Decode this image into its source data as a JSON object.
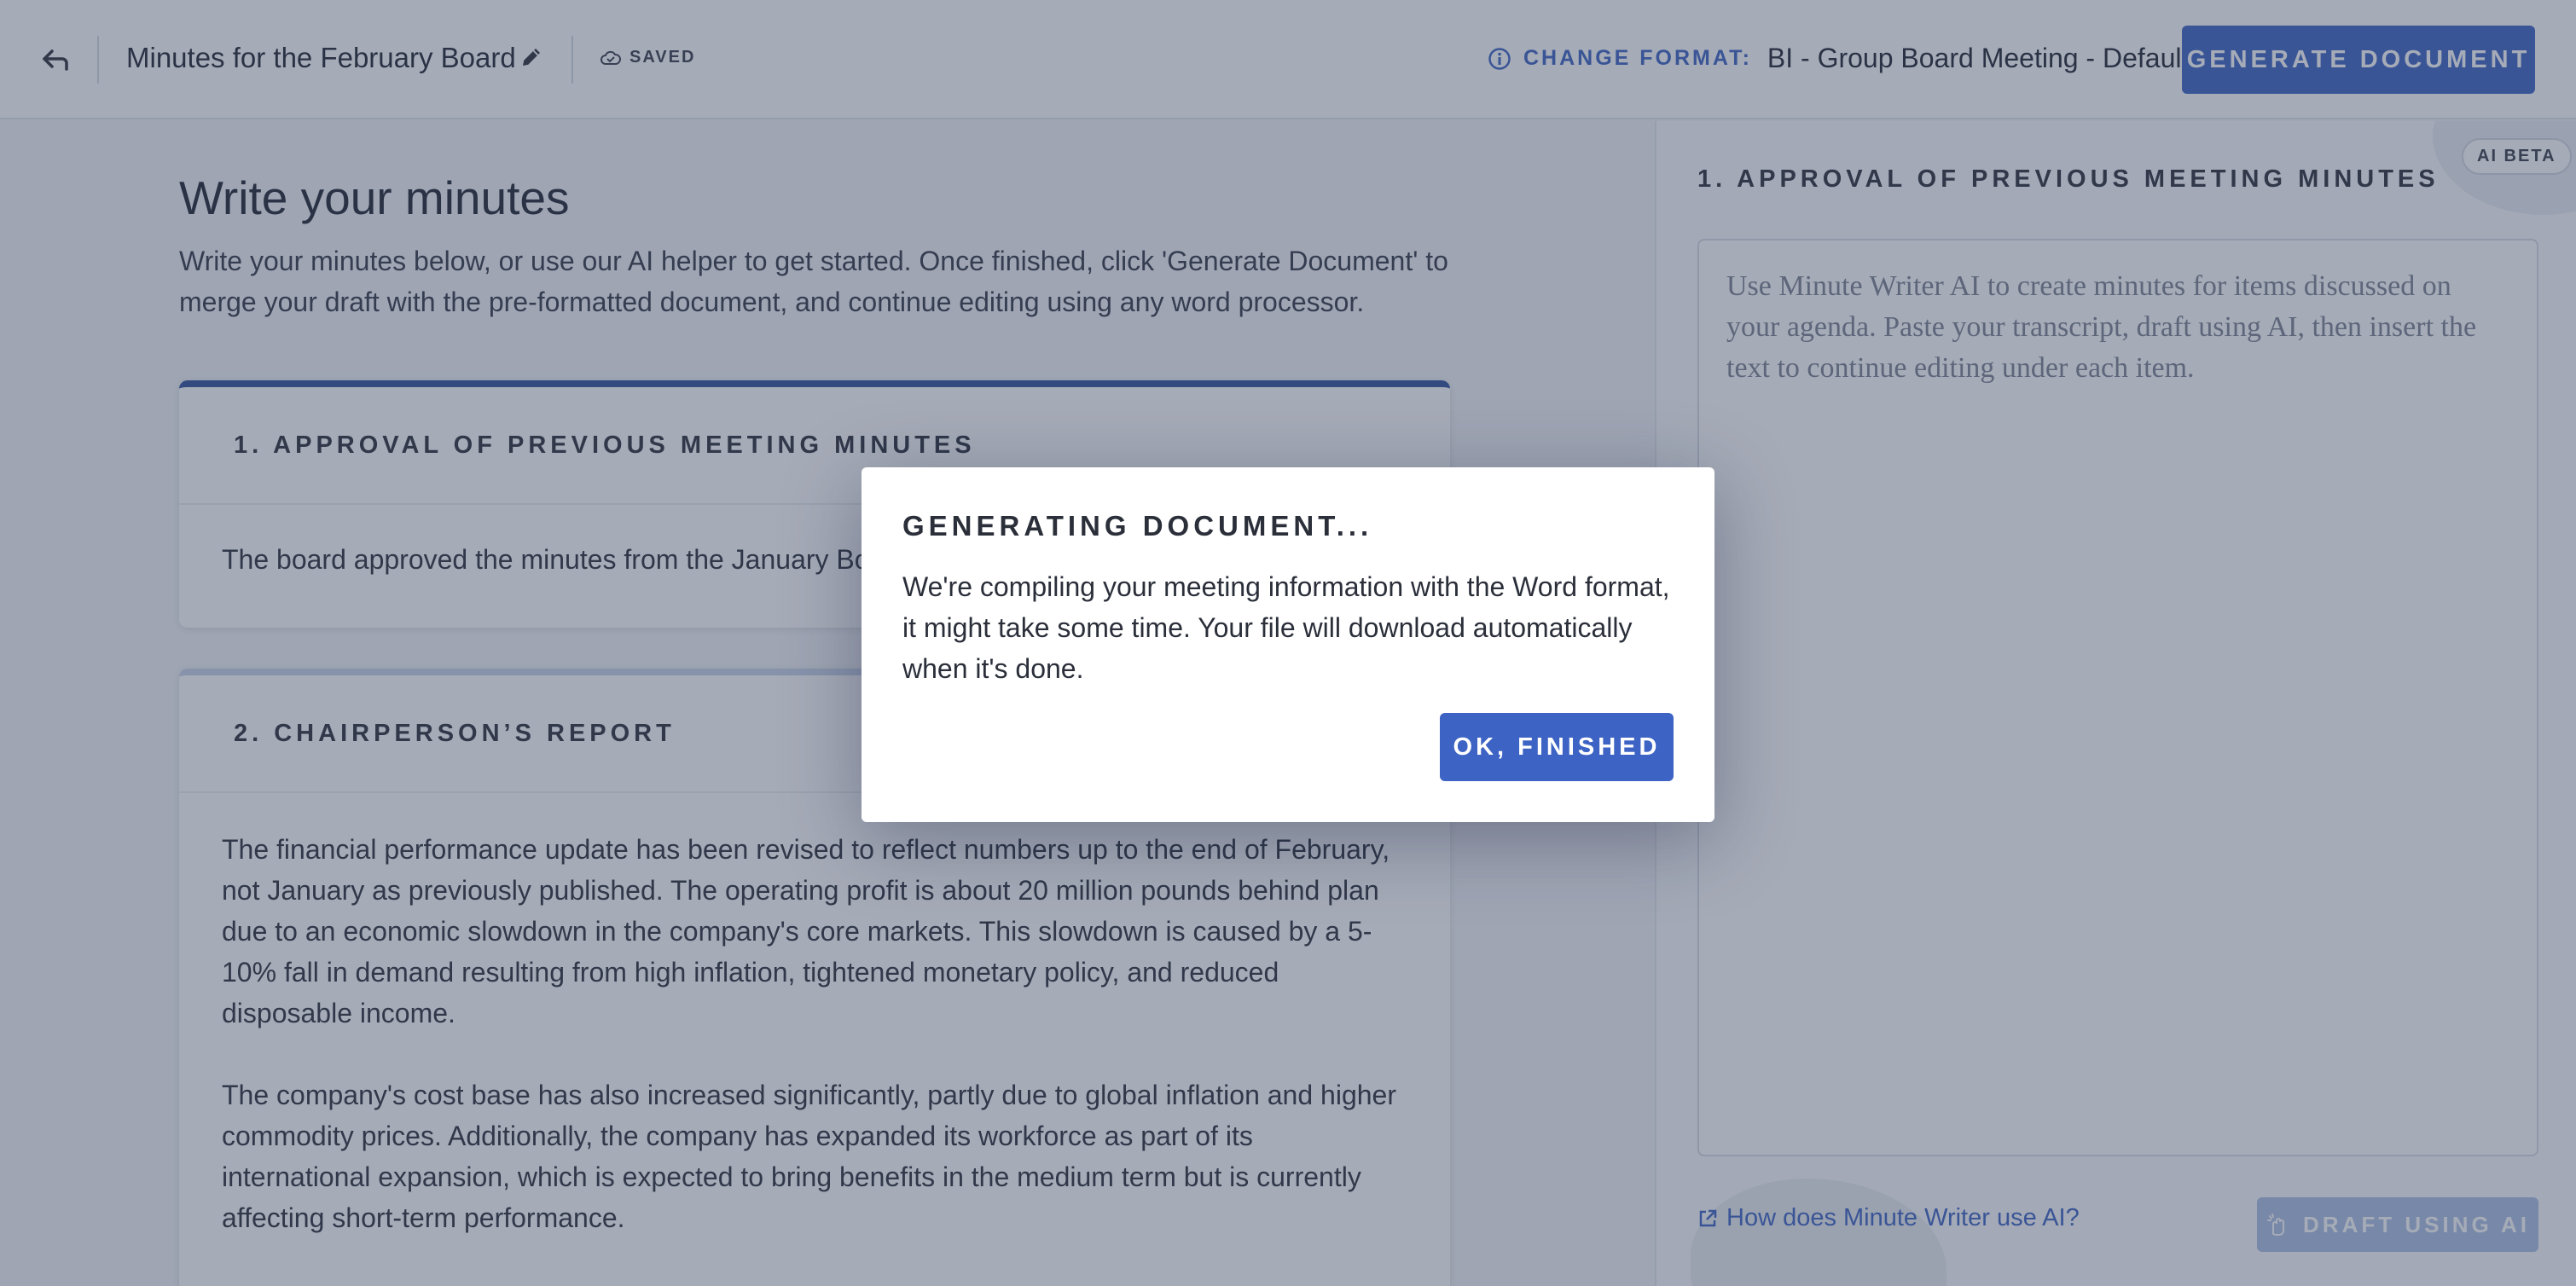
{
  "header": {
    "document_title": "Minutes for the February Board",
    "saved_label": "SAVED",
    "change_format_label": "CHANGE FORMAT:",
    "format_value": "BI - Group Board Meeting - Default",
    "generate_label": "GENERATE DOCUMENT",
    "icons": {
      "back": "back-arrow-icon",
      "edit": "pencil-icon",
      "saved": "cloud-check-icon",
      "info": "info-circle-icon"
    }
  },
  "main": {
    "heading": "Write your minutes",
    "description": "Write your minutes below, or use our AI helper to get started. Once finished, click 'Generate Document' to merge your draft with the pre-formatted document, and continue editing using any word processor.",
    "items": [
      {
        "title": "1. APPROVAL OF PREVIOUS MEETING MINUTES",
        "paragraphs": [
          "The board approved the minutes from the January Board meeting."
        ]
      },
      {
        "title": "2. CHAIRPERSON’S REPORT",
        "paragraphs": [
          "The financial performance update has been revised to reflect numbers up to the end of February, not January as previously published. The operating profit is about 20 million pounds behind plan due to an economic slowdown in the company's core markets. This slowdown is caused by a 5-10% fall in demand resulting from high inflation, tightened monetary policy, and reduced disposable income.",
          "The company's cost base has also increased significantly, partly due to global inflation and higher commodity prices. Additionally, the company has expanded its workforce as part of its international expansion, which is expected to bring benefits in the medium term but is currently affecting short-term performance."
        ]
      }
    ]
  },
  "ai_panel": {
    "badge": "AI BETA",
    "title": "1. APPROVAL OF PREVIOUS MEETING MINUTES",
    "placeholder": "Use Minute Writer AI to create minutes for items discussed on your agenda. Paste your transcript, draft using AI, then insert the text to continue editing under each item.",
    "help_link": "How does Minute Writer use AI?",
    "draft_label": "DRAFT USING AI"
  },
  "modal": {
    "title": "GENERATING DOCUMENT...",
    "message": "We're compiling your meeting information with the Word format, it might take some time. Your file will download automatically when it's done.",
    "ok_label": "OK, FINISHED"
  },
  "colors": {
    "accent": "#3d63c4",
    "card_active_border": "#2f4f9c",
    "overlay": "rgba(56,68,96,0.45)"
  }
}
